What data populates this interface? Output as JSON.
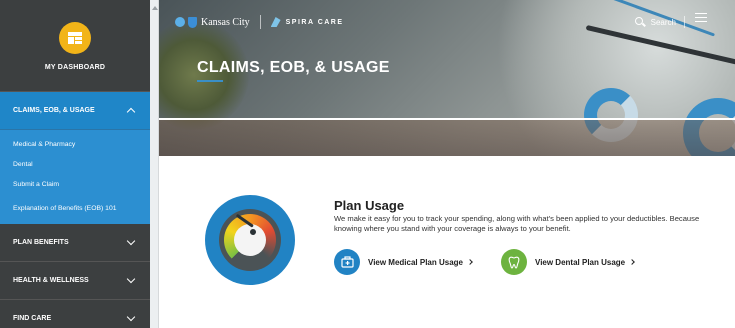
{
  "sidebar": {
    "dashboard_label": "MY DASHBOARD",
    "open_section": {
      "label": "CLAIMS, EOB, & USAGE",
      "items": [
        {
          "label": "Medical & Pharmacy"
        },
        {
          "label": "Dental"
        },
        {
          "label": "Submit a Claim"
        },
        {
          "label": "Explanation of Benefits (EOB) 101"
        }
      ]
    },
    "sections": [
      {
        "label": "PLAN BENEFITS"
      },
      {
        "label": "HEALTH & WELLNESS"
      },
      {
        "label": "FIND CARE"
      }
    ]
  },
  "header": {
    "brand_name": "Kansas City",
    "partner_name": "SPIRA CARE",
    "search_label": "Search",
    "page_title": "CLAIMS, EOB, & USAGE"
  },
  "main": {
    "title": "Plan Usage",
    "description": "We make it easy for you to track your spending, along with what's been applied to your deductibles. Because knowing where you stand with your coverage is always to your benefit.",
    "links": {
      "medical": "View Medical Plan Usage",
      "dental": "View Dental Plan Usage"
    }
  },
  "colors": {
    "sidebar_bg": "#3c3f40",
    "sidebar_active": "#1f86c8",
    "dashboard_icon": "#f2b418",
    "medical_icon": "#2183c4",
    "dental_icon": "#6db33f"
  },
  "icons": {
    "dashboard": "dashboard-icon",
    "medical": "medical-bag-icon",
    "dental": "tooth-icon",
    "gauge": "speedometer-icon",
    "search": "search-icon",
    "menu": "hamburger-menu-icon"
  }
}
